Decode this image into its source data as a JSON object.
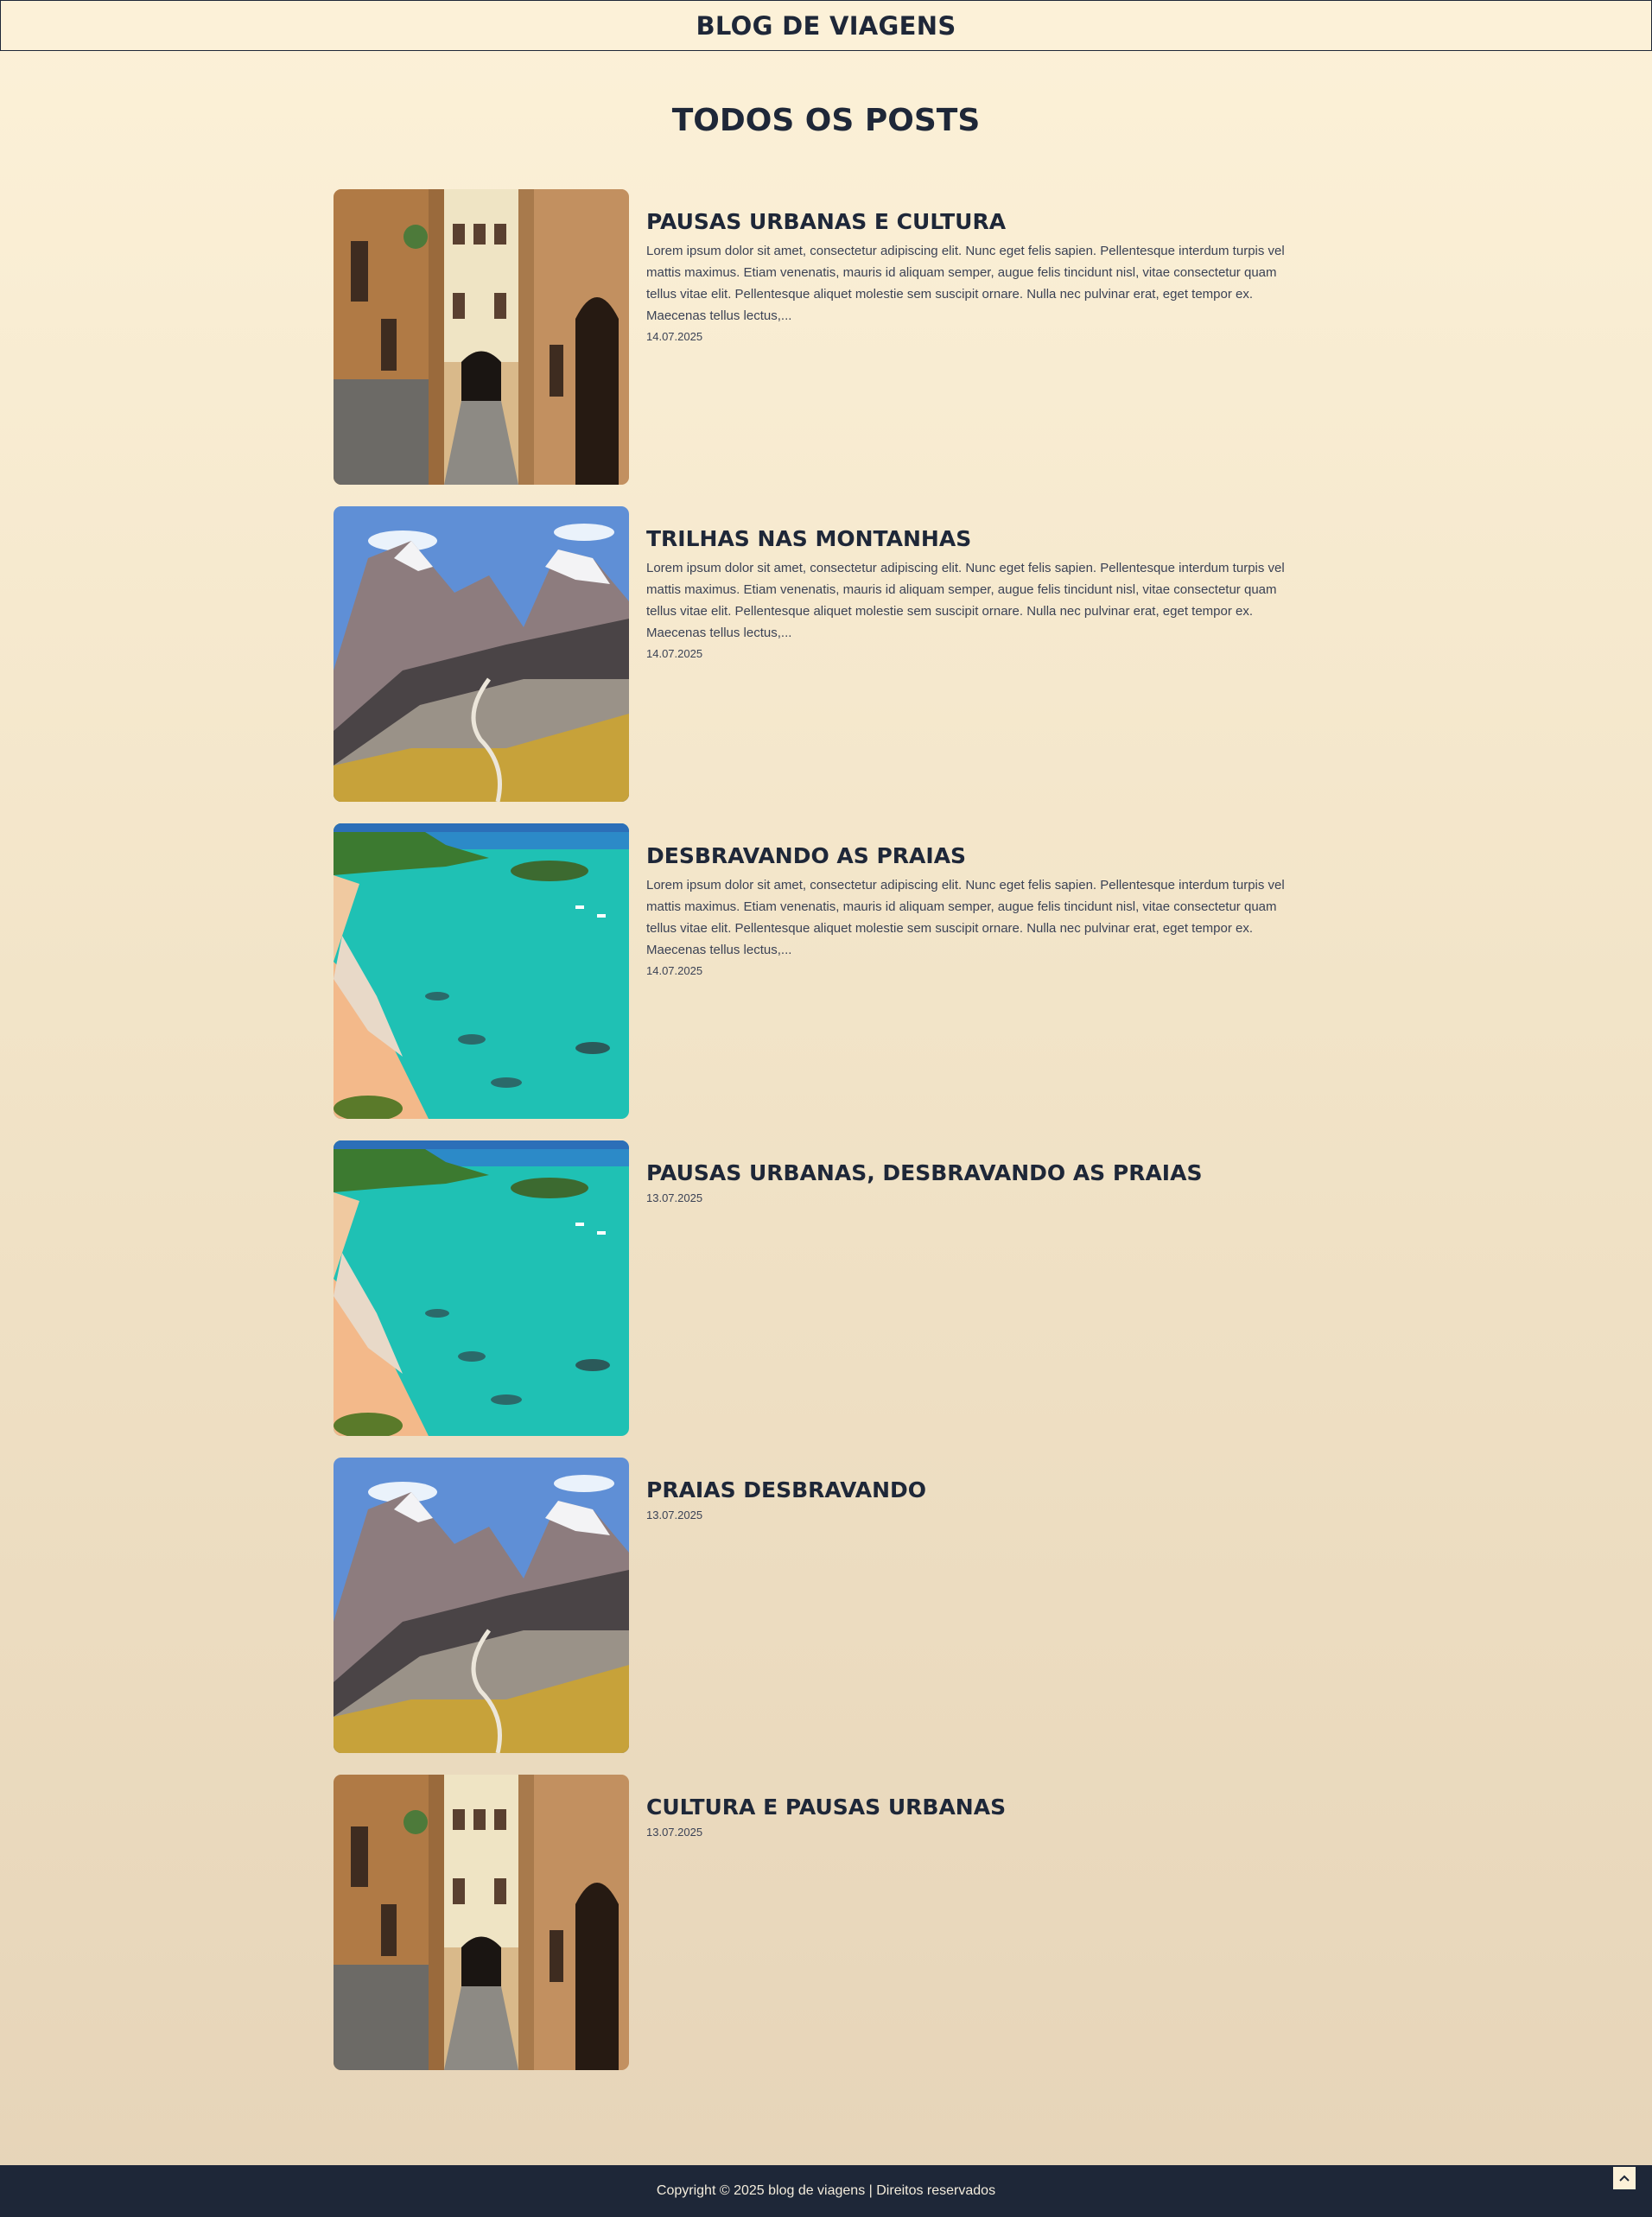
{
  "header": {
    "title": "BLOG DE VIAGENS"
  },
  "main": {
    "heading": "TODOS OS POSTS"
  },
  "posts": [
    {
      "image": "street-alley-photo",
      "title": "PAUSAS URBANAS E CULTURA",
      "excerpt": "Lorem ipsum dolor sit amet, consectetur adipiscing elit. Nunc eget felis sapien. Pellentesque interdum turpis vel mattis maximus. Etiam venenatis, mauris id aliquam semper, augue felis tincidunt nisl, vitae consectetur quam tellus vitae elit. Pellentesque aliquet molestie sem suscipit ornare. Nulla nec pulvinar erat, eget tempor ex. Maecenas tellus lectus,...",
      "date": "14.07.2025"
    },
    {
      "image": "mountain-trail-photo",
      "title": "TRILHAS NAS MONTANHAS",
      "excerpt": "Lorem ipsum dolor sit amet, consectetur adipiscing elit. Nunc eget felis sapien. Pellentesque interdum turpis vel mattis maximus. Etiam venenatis, mauris id aliquam semper, augue felis tincidunt nisl, vitae consectetur quam tellus vitae elit. Pellentesque aliquet molestie sem suscipit ornare. Nulla nec pulvinar erat, eget tempor ex. Maecenas tellus lectus,...",
      "date": "14.07.2025"
    },
    {
      "image": "beach-photo",
      "title": "DESBRAVANDO AS PRAIAS",
      "excerpt": "Lorem ipsum dolor sit amet, consectetur adipiscing elit. Nunc eget felis sapien. Pellentesque interdum turpis vel mattis maximus. Etiam venenatis, mauris id aliquam semper, augue felis tincidunt nisl, vitae consectetur quam tellus vitae elit. Pellentesque aliquet molestie sem suscipit ornare. Nulla nec pulvinar erat, eget tempor ex. Maecenas tellus lectus,...",
      "date": "14.07.2025"
    },
    {
      "image": "beach-photo",
      "title": "PAUSAS URBANAS, DESBRAVANDO AS PRAIAS",
      "excerpt": "",
      "date": "13.07.2025"
    },
    {
      "image": "mountain-trail-photo",
      "title": "PRAIAS DESBRAVANDO",
      "excerpt": "",
      "date": "13.07.2025"
    },
    {
      "image": "street-alley-photo",
      "title": "CULTURA E PAUSAS URBANAS",
      "excerpt": "",
      "date": "13.07.2025"
    }
  ],
  "footer": {
    "copyright": "Copyright © 2025 blog de viagens | Direitos reservados"
  },
  "back_to_top": {
    "icon": "chevron-up-icon"
  },
  "colors": {
    "navy": "#1e2738",
    "cream": "#fcf1d8",
    "sand": "#e6d4b8"
  }
}
